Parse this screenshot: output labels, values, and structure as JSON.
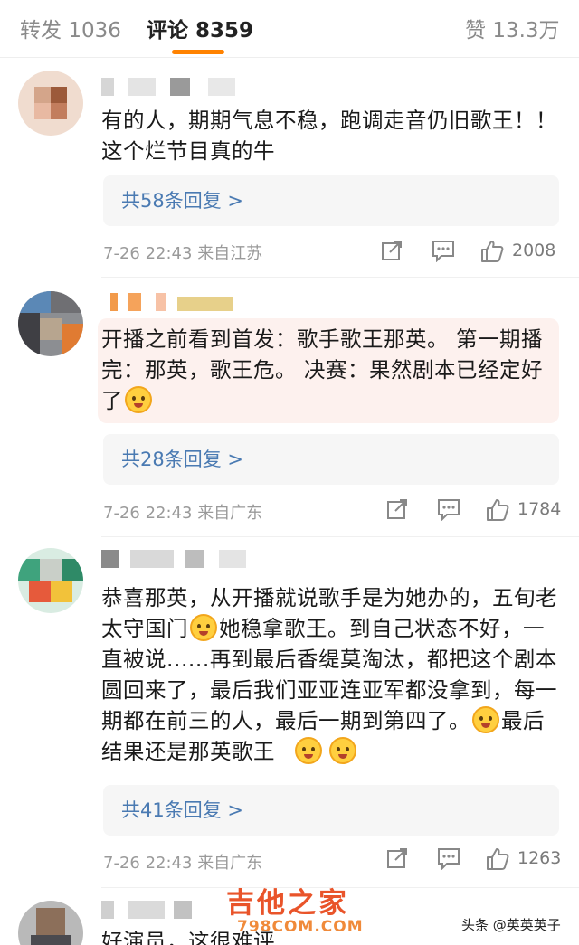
{
  "tabs": [
    {
      "label": "转发",
      "count": "1036"
    },
    {
      "label": "评论",
      "count": "8359"
    },
    {
      "label": "赞",
      "count": "13.3万"
    }
  ],
  "comments": [
    {
      "text": "有的人，期期气息不稳，跑调走音仍旧歌王！！这个烂节目真的牛",
      "replies": "共58条回复 >",
      "time": "7-26 22:43",
      "source": "来自江苏",
      "likes": "2008"
    },
    {
      "text_main": "开播之前看到首发：歌手歌王那英。 第一期播完：那英，歌王危。 决赛：果然剧本已经定好了",
      "replies": "共28条回复 >",
      "time": "7-26 22:43",
      "source": "来自广东",
      "likes": "1784"
    },
    {
      "text_a": "恭喜那英，从开播就说歌手是为她办的，五旬老太守国门",
      "text_b": "她稳拿歌王。到自己状态不好，一直被说......再到最后香缇莫淘汰，都把这个剧本圆回来了，最后我们亚亚连亚军都没拿到，每一期都在前三的人，最后一期到第四了。",
      "text_c": "最后结果还是那英歌王",
      "replies": "共41条回复 >",
      "time": "7-26 22:43",
      "source": "来自广东",
      "likes": "1263"
    },
    {
      "text": "好演员，这很难评"
    }
  ],
  "watermark": {
    "brand": "吉他之家",
    "site": "798COM.COM",
    "author": "头条 @英英英子"
  },
  "colors": {
    "accent": "#ff8200",
    "link": "#4a7ab2",
    "highlight_bg": "#fdf1ee"
  }
}
